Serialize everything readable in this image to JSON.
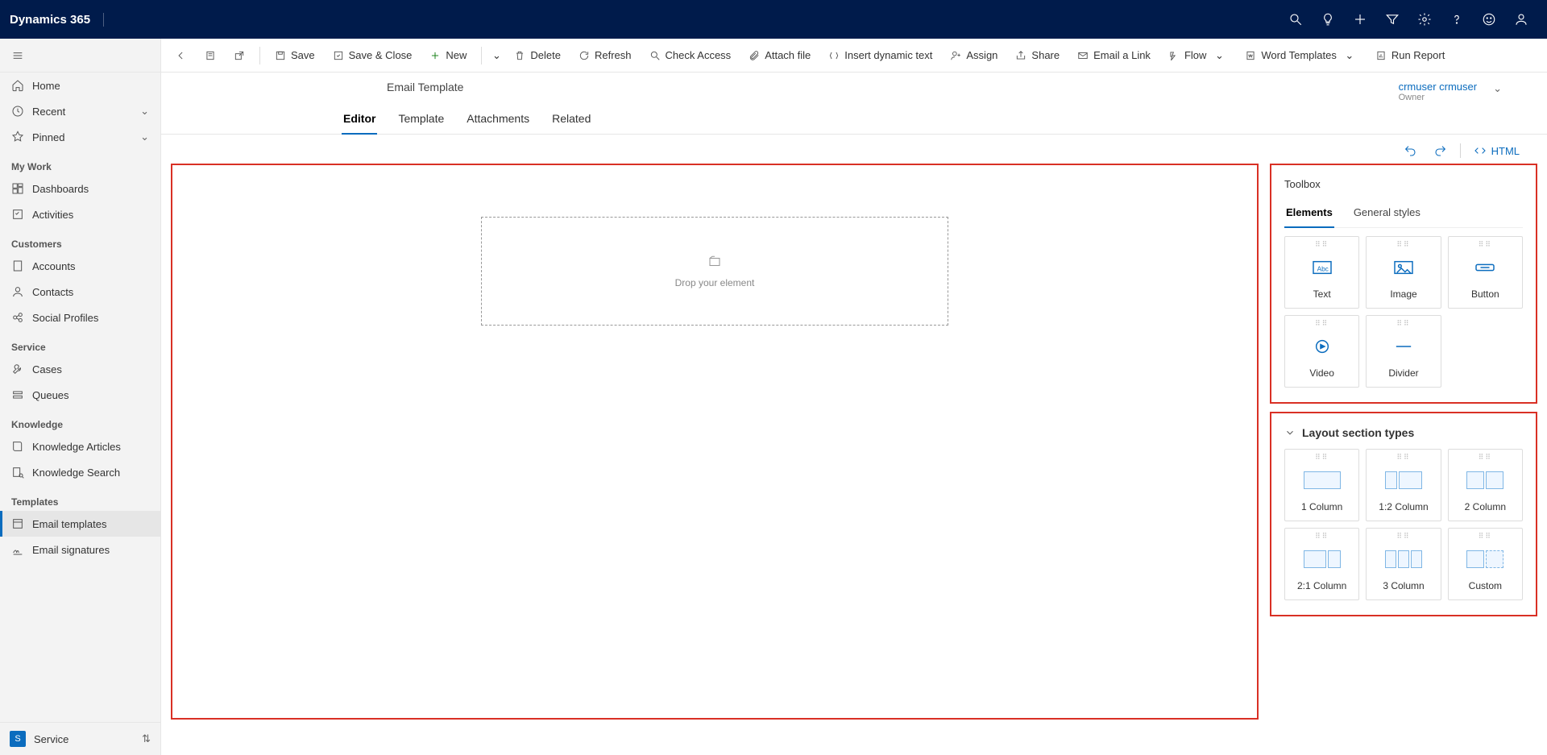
{
  "brand": "Dynamics 365",
  "top_icons": [
    "search",
    "lightbulb",
    "plus",
    "filter",
    "gear",
    "help",
    "smiley",
    "person"
  ],
  "sidebar": {
    "home": "Home",
    "recent": "Recent",
    "pinned": "Pinned",
    "sections": {
      "mywork": {
        "label": "My Work",
        "items": [
          "Dashboards",
          "Activities"
        ]
      },
      "customers": {
        "label": "Customers",
        "items": [
          "Accounts",
          "Contacts",
          "Social Profiles"
        ]
      },
      "service": {
        "label": "Service",
        "items": [
          "Cases",
          "Queues"
        ]
      },
      "knowledge": {
        "label": "Knowledge",
        "items": [
          "Knowledge Articles",
          "Knowledge Search"
        ]
      },
      "templates": {
        "label": "Templates",
        "items": [
          "Email templates",
          "Email signatures"
        ]
      }
    },
    "app_glyph": "S",
    "app_name": "Service"
  },
  "commands": {
    "save": "Save",
    "save_close": "Save & Close",
    "new": "New",
    "delete": "Delete",
    "refresh": "Refresh",
    "check_access": "Check Access",
    "attach_file": "Attach file",
    "insert_dynamic_text": "Insert dynamic text",
    "assign": "Assign",
    "share": "Share",
    "email_a_link": "Email a Link",
    "flow": "Flow",
    "word_templates": "Word Templates",
    "run_report": "Run Report"
  },
  "record": {
    "title": "Email Template",
    "owner_name": "crmuser crmuser",
    "owner_label": "Owner",
    "tabs": [
      "Editor",
      "Template",
      "Attachments",
      "Related"
    ]
  },
  "editor_toolbar": {
    "html": "HTML"
  },
  "dropzone": "Drop your element",
  "toolbox": {
    "title": "Toolbox",
    "tabs": [
      "Elements",
      "General styles"
    ],
    "elements": [
      "Text",
      "Image",
      "Button",
      "Video",
      "Divider"
    ],
    "layout_title": "Layout section types",
    "layouts": [
      "1 Column",
      "1:2 Column",
      "2 Column",
      "2:1 Column",
      "3 Column",
      "Custom"
    ]
  }
}
